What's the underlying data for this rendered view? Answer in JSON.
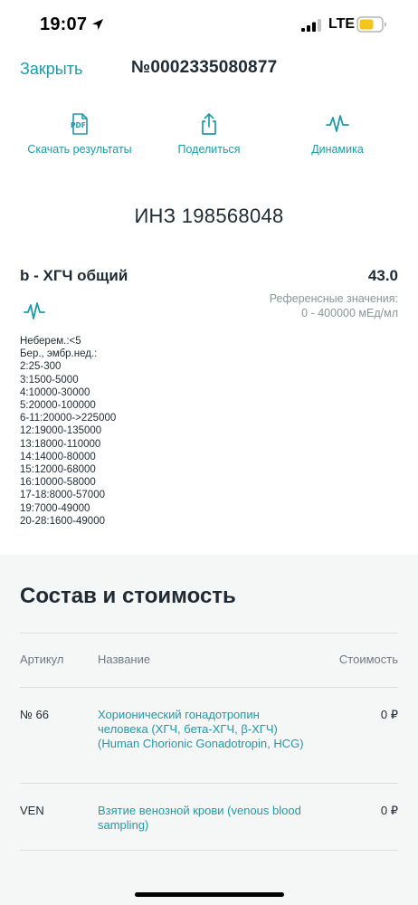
{
  "status_bar": {
    "time": "19:07",
    "network": "LTE"
  },
  "header": {
    "close_label": "Закрыть",
    "order_number": "№0002335080877"
  },
  "actions": [
    {
      "label": "Скачать результаты",
      "icon": "pdf-icon"
    },
    {
      "label": "Поделиться",
      "icon": "share-icon"
    },
    {
      "label": "Динамика",
      "icon": "dynamics-icon"
    }
  ],
  "inz": "ИНЗ 198568048",
  "result": {
    "name": "b - ХГЧ общий",
    "value": "43.0",
    "ref_label": "Референсные значения:",
    "ref_range": "0 - 400000 мЕд/мл",
    "notes": [
      "Неберем.:<5",
      "Бер., эмбр.нед.:",
      "2:25-300",
      "3:1500-5000",
      "4:10000-30000",
      "5:20000-100000",
      "6-11:20000->225000",
      "12:19000-135000",
      "13:18000-110000",
      "14:14000-80000",
      "15:12000-68000",
      "16:10000-58000",
      "17-18:8000-57000",
      "19:7000-49000",
      "20-28:1600-49000"
    ]
  },
  "composition": {
    "title": "Состав и стоимость",
    "headers": {
      "article": "Артикул",
      "name": "Название",
      "cost": "Стоимость"
    },
    "rows": [
      {
        "article": "№ 66",
        "name": "Хорионический гонадотропин человека (ХГЧ, бета-ХГЧ, β-ХГЧ) (Human Chorionic Gonadotropin, HCG)",
        "price": "0 ₽"
      },
      {
        "article": "VEN",
        "name": "Взятие венозной крови (venous blood sampling)",
        "price": "0 ₽"
      }
    ]
  },
  "colors": {
    "accent": "#1f9aa6",
    "text": "#1f2a33",
    "muted": "#8a949c",
    "section_bg": "#f5f6f6"
  }
}
